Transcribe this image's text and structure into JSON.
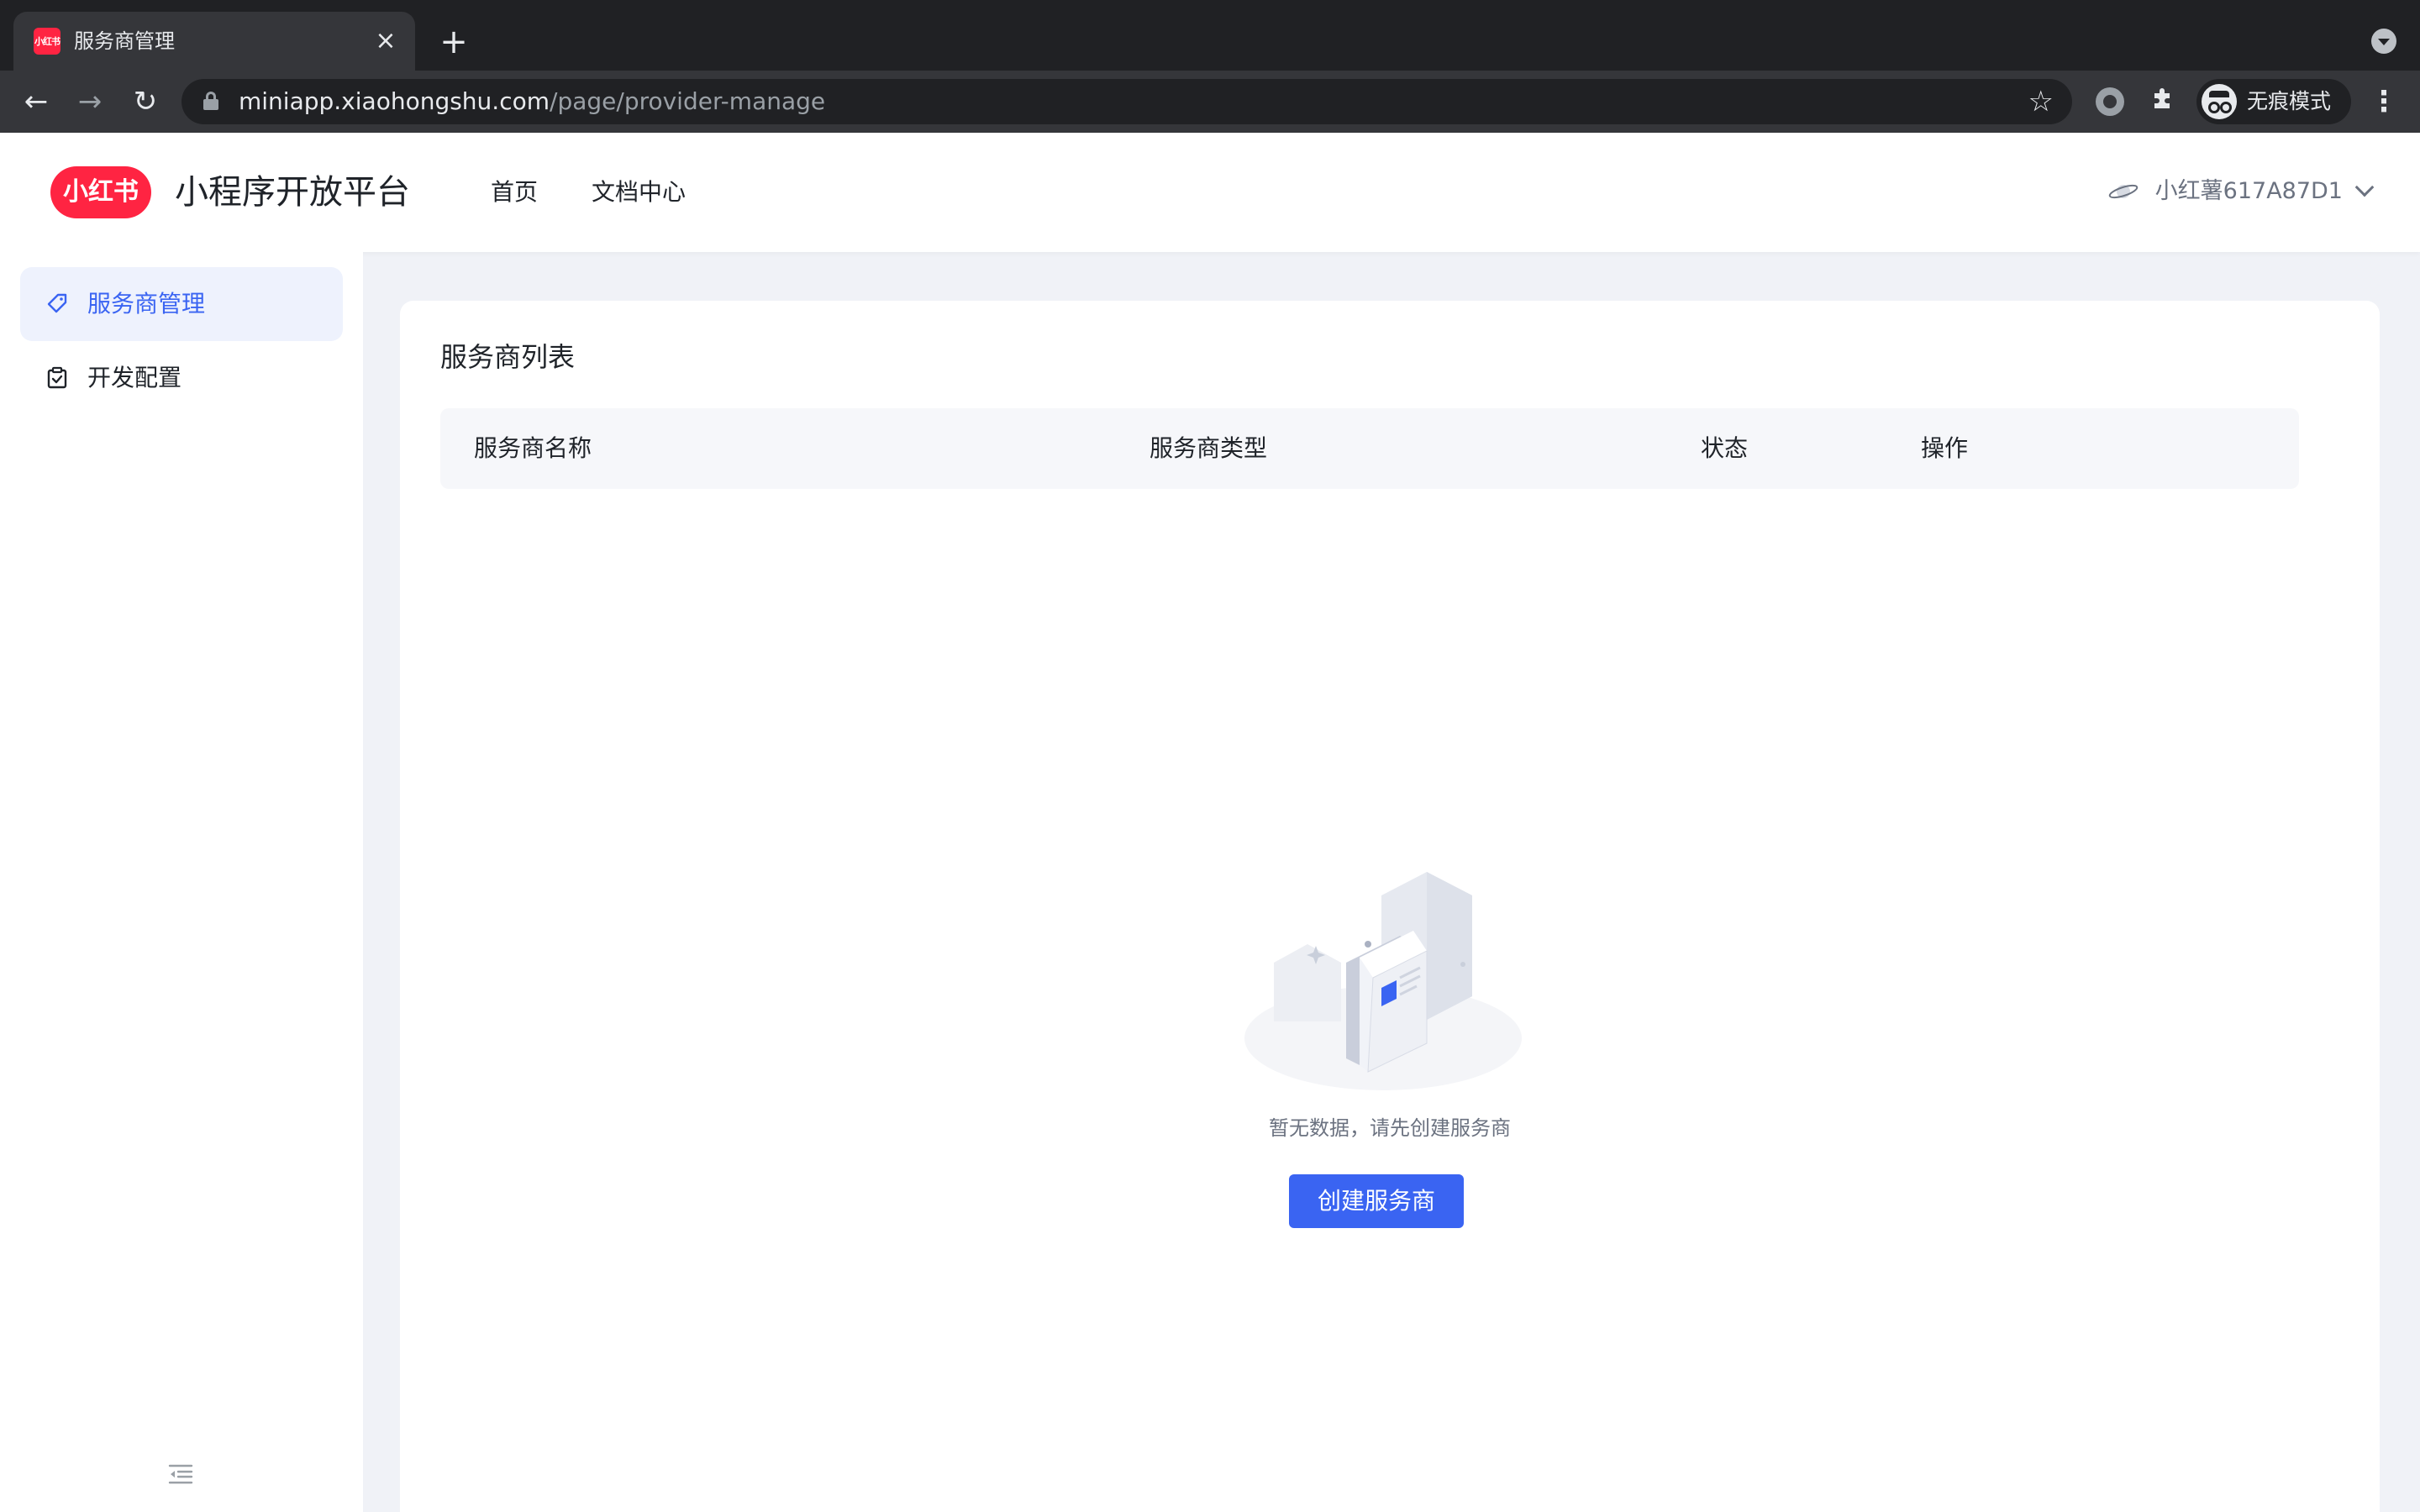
{
  "browser": {
    "tab_title": "服务商管理",
    "tab_favicon_text": "小红书",
    "url_host": "miniapp.xiaohongshu.com",
    "url_path": "/page/provider-manage",
    "incognito_label": "无痕模式"
  },
  "header": {
    "logo_text": "小红书",
    "platform_title": "小程序开放平台",
    "nav": [
      "首页",
      "文档中心"
    ],
    "user_name": "小红薯617A87D1"
  },
  "sidebar": {
    "items": [
      {
        "label": "服务商管理",
        "icon": "tag-icon",
        "active": true
      },
      {
        "label": "开发配置",
        "icon": "clipboard-check-icon",
        "active": false
      }
    ]
  },
  "main": {
    "card_title": "服务商列表",
    "table": {
      "columns": [
        "服务商名称",
        "服务商类型",
        "状态",
        "操作"
      ],
      "rows": []
    },
    "empty_text": "暂无数据，请先创建服务商",
    "create_button": "创建服务商"
  },
  "colors": {
    "brand_red": "#ff2442",
    "primary_blue": "#3a64f2",
    "page_bg": "#f0f2f7"
  }
}
